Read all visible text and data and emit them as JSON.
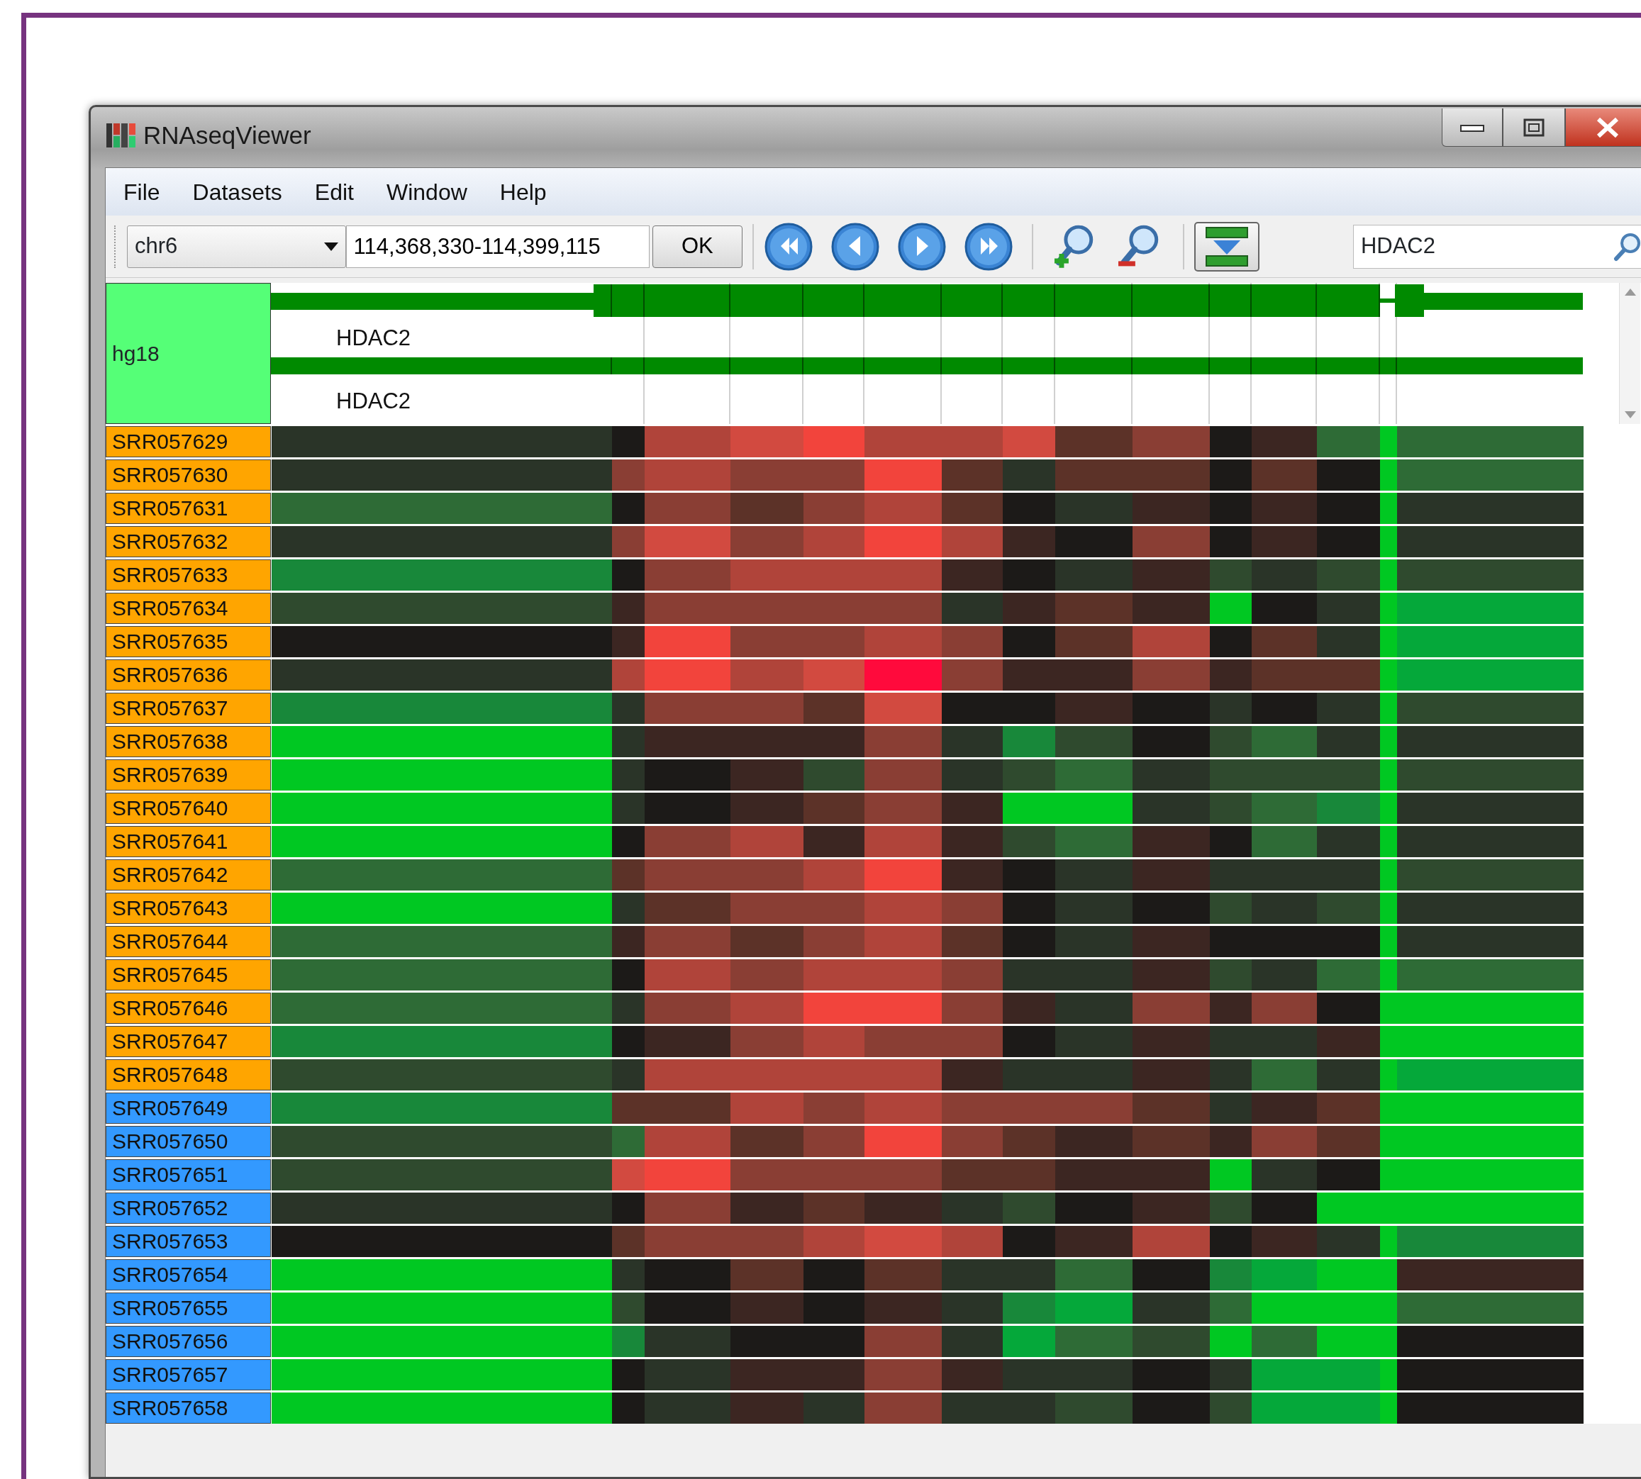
{
  "window": {
    "title": "RNAseqViewer"
  },
  "menu": [
    "File",
    "Datasets",
    "Edit",
    "Window",
    "Help"
  ],
  "toolbar": {
    "chromosome": "chr6",
    "location": "114,368,330-114,399,115",
    "ok_button": "OK",
    "search": "HDAC2"
  },
  "genome": {
    "label": "hg18",
    "tracks": [
      {
        "gene": "HDAC2"
      },
      {
        "gene": "HDAC2"
      }
    ]
  },
  "samples": [
    {
      "label": "SRR057629",
      "color": "#ffa500",
      "cells": [
        {
          "color": "#2a3428"
        },
        {
          "color": "#1c1a18"
        },
        {
          "color": "#b0443a"
        },
        {
          "color": "#d24a40"
        },
        {
          "color": "#f2443c"
        },
        {
          "color": "#b0443a"
        },
        {
          "color": "#b0443a"
        },
        {
          "color": "#d24a40"
        },
        {
          "color": "#5c3228"
        },
        {
          "color": "#8a3e34"
        },
        {
          "color": "#1c1a18"
        },
        {
          "color": "#3c2622"
        },
        {
          "color": "#2e6b36"
        },
        {
          "color": "#00c822"
        },
        {
          "color": "#2e6b36"
        }
      ]
    },
    {
      "label": "SRR057630",
      "color": "#ffa500",
      "cells": [
        {
          "color": "#2a3428"
        },
        {
          "color": "#8a3e34"
        },
        {
          "color": "#b0443a"
        },
        {
          "color": "#8a3e34"
        },
        {
          "color": "#8a3e34"
        },
        {
          "color": "#f2443c"
        },
        {
          "color": "#5c3228"
        },
        {
          "color": "#2a3428"
        },
        {
          "color": "#5c3228"
        },
        {
          "color": "#5c3228"
        },
        {
          "color": "#1c1a18"
        },
        {
          "color": "#5c3228"
        },
        {
          "color": "#1c1a18"
        },
        {
          "color": "#00c822"
        },
        {
          "color": "#2e6b36"
        }
      ]
    },
    {
      "label": "SRR057631",
      "color": "#ffa500",
      "cells": [
        {
          "color": "#2e6b36"
        },
        {
          "color": "#1c1a18"
        },
        {
          "color": "#8a3e34"
        },
        {
          "color": "#5c3228"
        },
        {
          "color": "#8a3e34"
        },
        {
          "color": "#b0443a"
        },
        {
          "color": "#5c3228"
        },
        {
          "color": "#1c1a18"
        },
        {
          "color": "#2a3428"
        },
        {
          "color": "#3c2622"
        },
        {
          "color": "#1c1a18"
        },
        {
          "color": "#3c2622"
        },
        {
          "color": "#1c1a18"
        },
        {
          "color": "#00c822"
        },
        {
          "color": "#2a3428"
        }
      ]
    },
    {
      "label": "SRR057632",
      "color": "#ffa500",
      "cells": [
        {
          "color": "#2a3428"
        },
        {
          "color": "#8a3e34"
        },
        {
          "color": "#d24a40"
        },
        {
          "color": "#8a3e34"
        },
        {
          "color": "#b0443a"
        },
        {
          "color": "#f2443c"
        },
        {
          "color": "#b0443a"
        },
        {
          "color": "#3c2622"
        },
        {
          "color": "#1c1a18"
        },
        {
          "color": "#8a3e34"
        },
        {
          "color": "#1c1a18"
        },
        {
          "color": "#3c2622"
        },
        {
          "color": "#1c1a18"
        },
        {
          "color": "#00c822"
        },
        {
          "color": "#2a3428"
        }
      ]
    },
    {
      "label": "SRR057633",
      "color": "#ffa500",
      "cells": [
        {
          "color": "#18883a"
        },
        {
          "color": "#1c1a18"
        },
        {
          "color": "#8a3e34"
        },
        {
          "color": "#b0443a"
        },
        {
          "color": "#b0443a"
        },
        {
          "color": "#b0443a"
        },
        {
          "color": "#3c2622"
        },
        {
          "color": "#1c1a18"
        },
        {
          "color": "#2a3428"
        },
        {
          "color": "#3c2622"
        },
        {
          "color": "#2f4a2e"
        },
        {
          "color": "#2a3428"
        },
        {
          "color": "#2f4a2e"
        },
        {
          "color": "#00c822"
        },
        {
          "color": "#2f4a2e"
        }
      ]
    },
    {
      "label": "SRR057634",
      "color": "#ffa500",
      "cells": [
        {
          "color": "#2f4a2e"
        },
        {
          "color": "#3c2622"
        },
        {
          "color": "#8a3e34"
        },
        {
          "color": "#8a3e34"
        },
        {
          "color": "#8a3e34"
        },
        {
          "color": "#8a3e34"
        },
        {
          "color": "#2a3428"
        },
        {
          "color": "#3c2622"
        },
        {
          "color": "#5c3228"
        },
        {
          "color": "#3c2622"
        },
        {
          "color": "#00c822"
        },
        {
          "color": "#1c1a18"
        },
        {
          "color": "#2a3428"
        },
        {
          "color": "#00c822"
        },
        {
          "color": "#05a83a"
        }
      ]
    },
    {
      "label": "SRR057635",
      "color": "#ffa500",
      "cells": [
        {
          "color": "#1c1a18"
        },
        {
          "color": "#3c2622"
        },
        {
          "color": "#f2443c"
        },
        {
          "color": "#8a3e34"
        },
        {
          "color": "#8a3e34"
        },
        {
          "color": "#b0443a"
        },
        {
          "color": "#8a3e34"
        },
        {
          "color": "#1c1a18"
        },
        {
          "color": "#5c3228"
        },
        {
          "color": "#b0443a"
        },
        {
          "color": "#1c1a18"
        },
        {
          "color": "#5c3228"
        },
        {
          "color": "#2a3428"
        },
        {
          "color": "#00c822"
        },
        {
          "color": "#05a83a"
        }
      ]
    },
    {
      "label": "SRR057636",
      "color": "#ffa500",
      "cells": [
        {
          "color": "#2a3428"
        },
        {
          "color": "#b0443a"
        },
        {
          "color": "#f2443c"
        },
        {
          "color": "#b0443a"
        },
        {
          "color": "#d24a40"
        },
        {
          "color": "#ff0a3c"
        },
        {
          "color": "#8a3e34"
        },
        {
          "color": "#3c2622"
        },
        {
          "color": "#3c2622"
        },
        {
          "color": "#8a3e34"
        },
        {
          "color": "#3c2622"
        },
        {
          "color": "#5c3228"
        },
        {
          "color": "#5c3228"
        },
        {
          "color": "#00c822"
        },
        {
          "color": "#05a83a"
        }
      ]
    },
    {
      "label": "SRR057637",
      "color": "#ffa500",
      "cells": [
        {
          "color": "#18883a"
        },
        {
          "color": "#2a3428"
        },
        {
          "color": "#8a3e34"
        },
        {
          "color": "#8a3e34"
        },
        {
          "color": "#5c3228"
        },
        {
          "color": "#d24a40"
        },
        {
          "color": "#1c1a18"
        },
        {
          "color": "#1c1a18"
        },
        {
          "color": "#3c2622"
        },
        {
          "color": "#1c1a18"
        },
        {
          "color": "#2a3428"
        },
        {
          "color": "#1c1a18"
        },
        {
          "color": "#2a3428"
        },
        {
          "color": "#00c822"
        },
        {
          "color": "#2f4a2e"
        }
      ]
    },
    {
      "label": "SRR057638",
      "color": "#ffa500",
      "cells": [
        {
          "color": "#00c822"
        },
        {
          "color": "#2a3428"
        },
        {
          "color": "#3c2622"
        },
        {
          "color": "#3c2622"
        },
        {
          "color": "#3c2622"
        },
        {
          "color": "#8a3e34"
        },
        {
          "color": "#2a3428"
        },
        {
          "color": "#18883a"
        },
        {
          "color": "#2f4a2e"
        },
        {
          "color": "#1c1a18"
        },
        {
          "color": "#2f4a2e"
        },
        {
          "color": "#2e6b36"
        },
        {
          "color": "#2a3428"
        },
        {
          "color": "#00c822"
        },
        {
          "color": "#2a3428"
        }
      ]
    },
    {
      "label": "SRR057639",
      "color": "#ffa500",
      "cells": [
        {
          "color": "#00c822"
        },
        {
          "color": "#2a3428"
        },
        {
          "color": "#1c1a18"
        },
        {
          "color": "#3c2622"
        },
        {
          "color": "#2f4a2e"
        },
        {
          "color": "#8a3e34"
        },
        {
          "color": "#2a3428"
        },
        {
          "color": "#2f4a2e"
        },
        {
          "color": "#2e6b36"
        },
        {
          "color": "#2a3428"
        },
        {
          "color": "#2f4a2e"
        },
        {
          "color": "#2f4a2e"
        },
        {
          "color": "#2f4a2e"
        },
        {
          "color": "#00c822"
        },
        {
          "color": "#2f4a2e"
        }
      ]
    },
    {
      "label": "SRR057640",
      "color": "#ffa500",
      "cells": [
        {
          "color": "#00c822"
        },
        {
          "color": "#2a3428"
        },
        {
          "color": "#1c1a18"
        },
        {
          "color": "#3c2622"
        },
        {
          "color": "#5c3228"
        },
        {
          "color": "#8a3e34"
        },
        {
          "color": "#3c2622"
        },
        {
          "color": "#00c822"
        },
        {
          "color": "#00c822"
        },
        {
          "color": "#2a3428"
        },
        {
          "color": "#2f4a2e"
        },
        {
          "color": "#2e6b36"
        },
        {
          "color": "#18883a"
        },
        {
          "color": "#00c822"
        },
        {
          "color": "#2a3428"
        }
      ]
    },
    {
      "label": "SRR057641",
      "color": "#ffa500",
      "cells": [
        {
          "color": "#00c822"
        },
        {
          "color": "#1c1a18"
        },
        {
          "color": "#8a3e34"
        },
        {
          "color": "#b0443a"
        },
        {
          "color": "#3c2622"
        },
        {
          "color": "#b0443a"
        },
        {
          "color": "#3c2622"
        },
        {
          "color": "#2f4a2e"
        },
        {
          "color": "#2e6b36"
        },
        {
          "color": "#3c2622"
        },
        {
          "color": "#1c1a18"
        },
        {
          "color": "#2e6b36"
        },
        {
          "color": "#2a3428"
        },
        {
          "color": "#00c822"
        },
        {
          "color": "#2a3428"
        }
      ]
    },
    {
      "label": "SRR057642",
      "color": "#ffa500",
      "cells": [
        {
          "color": "#2e6b36"
        },
        {
          "color": "#5c3228"
        },
        {
          "color": "#8a3e34"
        },
        {
          "color": "#8a3e34"
        },
        {
          "color": "#b0443a"
        },
        {
          "color": "#f2443c"
        },
        {
          "color": "#3c2622"
        },
        {
          "color": "#1c1a18"
        },
        {
          "color": "#2a3428"
        },
        {
          "color": "#3c2622"
        },
        {
          "color": "#2a3428"
        },
        {
          "color": "#2a3428"
        },
        {
          "color": "#2a3428"
        },
        {
          "color": "#00c822"
        },
        {
          "color": "#2f4a2e"
        }
      ]
    },
    {
      "label": "SRR057643",
      "color": "#ffa500",
      "cells": [
        {
          "color": "#00c822"
        },
        {
          "color": "#2a3428"
        },
        {
          "color": "#5c3228"
        },
        {
          "color": "#8a3e34"
        },
        {
          "color": "#8a3e34"
        },
        {
          "color": "#b0443a"
        },
        {
          "color": "#8a3e34"
        },
        {
          "color": "#1c1a18"
        },
        {
          "color": "#2a3428"
        },
        {
          "color": "#1c1a18"
        },
        {
          "color": "#2f4a2e"
        },
        {
          "color": "#2a3428"
        },
        {
          "color": "#2f4a2e"
        },
        {
          "color": "#00c822"
        },
        {
          "color": "#2a3428"
        }
      ]
    },
    {
      "label": "SRR057644",
      "color": "#ffa500",
      "cells": [
        {
          "color": "#2e6b36"
        },
        {
          "color": "#3c2622"
        },
        {
          "color": "#8a3e34"
        },
        {
          "color": "#5c3228"
        },
        {
          "color": "#8a3e34"
        },
        {
          "color": "#b0443a"
        },
        {
          "color": "#5c3228"
        },
        {
          "color": "#1c1a18"
        },
        {
          "color": "#2a3428"
        },
        {
          "color": "#3c2622"
        },
        {
          "color": "#1c1a18"
        },
        {
          "color": "#1c1a18"
        },
        {
          "color": "#1c1a18"
        },
        {
          "color": "#00c822"
        },
        {
          "color": "#2a3428"
        }
      ]
    },
    {
      "label": "SRR057645",
      "color": "#ffa500",
      "cells": [
        {
          "color": "#2e6b36"
        },
        {
          "color": "#1c1a18"
        },
        {
          "color": "#b0443a"
        },
        {
          "color": "#8a3e34"
        },
        {
          "color": "#b0443a"
        },
        {
          "color": "#b0443a"
        },
        {
          "color": "#8a3e34"
        },
        {
          "color": "#2a3428"
        },
        {
          "color": "#2a3428"
        },
        {
          "color": "#3c2622"
        },
        {
          "color": "#2f4a2e"
        },
        {
          "color": "#2a3428"
        },
        {
          "color": "#2e6b36"
        },
        {
          "color": "#00c822"
        },
        {
          "color": "#2e6b36"
        }
      ]
    },
    {
      "label": "SRR057646",
      "color": "#ffa500",
      "cells": [
        {
          "color": "#2e6b36"
        },
        {
          "color": "#2a3428"
        },
        {
          "color": "#8a3e34"
        },
        {
          "color": "#b0443a"
        },
        {
          "color": "#f2443c"
        },
        {
          "color": "#f2443c"
        },
        {
          "color": "#8a3e34"
        },
        {
          "color": "#3c2622"
        },
        {
          "color": "#2a3428"
        },
        {
          "color": "#8a3e34"
        },
        {
          "color": "#3c2622"
        },
        {
          "color": "#8a3e34"
        },
        {
          "color": "#1c1a18"
        },
        {
          "color": "#00c822"
        },
        {
          "color": "#00c822"
        }
      ]
    },
    {
      "label": "SRR057647",
      "color": "#ffa500",
      "cells": [
        {
          "color": "#18883a"
        },
        {
          "color": "#1c1a18"
        },
        {
          "color": "#3c2622"
        },
        {
          "color": "#8a3e34"
        },
        {
          "color": "#b0443a"
        },
        {
          "color": "#8a3e34"
        },
        {
          "color": "#8a3e34"
        },
        {
          "color": "#1c1a18"
        },
        {
          "color": "#2a3428"
        },
        {
          "color": "#3c2622"
        },
        {
          "color": "#2a3428"
        },
        {
          "color": "#2a3428"
        },
        {
          "color": "#3c2622"
        },
        {
          "color": "#00c822"
        },
        {
          "color": "#00c822"
        }
      ]
    },
    {
      "label": "SRR057648",
      "color": "#ffa500",
      "cells": [
        {
          "color": "#2f4a2e"
        },
        {
          "color": "#2a3428"
        },
        {
          "color": "#b0443a"
        },
        {
          "color": "#b0443a"
        },
        {
          "color": "#b0443a"
        },
        {
          "color": "#b0443a"
        },
        {
          "color": "#3c2622"
        },
        {
          "color": "#2a3428"
        },
        {
          "color": "#2a3428"
        },
        {
          "color": "#3c2622"
        },
        {
          "color": "#2a3428"
        },
        {
          "color": "#2e6b36"
        },
        {
          "color": "#2a3428"
        },
        {
          "color": "#00c822"
        },
        {
          "color": "#05a83a"
        }
      ]
    },
    {
      "label": "SRR057649",
      "color": "#3399ff",
      "cells": [
        {
          "color": "#18883a"
        },
        {
          "color": "#5c3228"
        },
        {
          "color": "#5c3228"
        },
        {
          "color": "#b0443a"
        },
        {
          "color": "#8a3e34"
        },
        {
          "color": "#b0443a"
        },
        {
          "color": "#8a3e34"
        },
        {
          "color": "#8a3e34"
        },
        {
          "color": "#8a3e34"
        },
        {
          "color": "#5c3228"
        },
        {
          "color": "#2a3428"
        },
        {
          "color": "#3c2622"
        },
        {
          "color": "#5c3228"
        },
        {
          "color": "#00c822"
        },
        {
          "color": "#00c822"
        }
      ]
    },
    {
      "label": "SRR057650",
      "color": "#3399ff",
      "cells": [
        {
          "color": "#2f4a2e"
        },
        {
          "color": "#2e6b36"
        },
        {
          "color": "#b0443a"
        },
        {
          "color": "#5c3228"
        },
        {
          "color": "#8a3e34"
        },
        {
          "color": "#f2443c"
        },
        {
          "color": "#8a3e34"
        },
        {
          "color": "#5c3228"
        },
        {
          "color": "#3c2622"
        },
        {
          "color": "#5c3228"
        },
        {
          "color": "#3c2622"
        },
        {
          "color": "#8a3e34"
        },
        {
          "color": "#5c3228"
        },
        {
          "color": "#00c822"
        },
        {
          "color": "#00c822"
        }
      ]
    },
    {
      "label": "SRR057651",
      "color": "#3399ff",
      "cells": [
        {
          "color": "#2f4a2e"
        },
        {
          "color": "#d24a40"
        },
        {
          "color": "#f2443c"
        },
        {
          "color": "#8a3e34"
        },
        {
          "color": "#8a3e34"
        },
        {
          "color": "#8a3e34"
        },
        {
          "color": "#5c3228"
        },
        {
          "color": "#5c3228"
        },
        {
          "color": "#3c2622"
        },
        {
          "color": "#3c2622"
        },
        {
          "color": "#00c822"
        },
        {
          "color": "#2a3428"
        },
        {
          "color": "#1c1a18"
        },
        {
          "color": "#00c822"
        },
        {
          "color": "#00c822"
        }
      ]
    },
    {
      "label": "SRR057652",
      "color": "#3399ff",
      "cells": [
        {
          "color": "#2a3428"
        },
        {
          "color": "#1c1a18"
        },
        {
          "color": "#8a3e34"
        },
        {
          "color": "#3c2622"
        },
        {
          "color": "#5c3228"
        },
        {
          "color": "#3c2622"
        },
        {
          "color": "#2a3428"
        },
        {
          "color": "#2f4a2e"
        },
        {
          "color": "#1c1a18"
        },
        {
          "color": "#3c2622"
        },
        {
          "color": "#2f4a2e"
        },
        {
          "color": "#1c1a18"
        },
        {
          "color": "#00c822"
        },
        {
          "color": "#00c822"
        },
        {
          "color": "#00c822"
        }
      ]
    },
    {
      "label": "SRR057653",
      "color": "#3399ff",
      "cells": [
        {
          "color": "#1c1a18"
        },
        {
          "color": "#5c3228"
        },
        {
          "color": "#8a3e34"
        },
        {
          "color": "#8a3e34"
        },
        {
          "color": "#b0443a"
        },
        {
          "color": "#d24a40"
        },
        {
          "color": "#b0443a"
        },
        {
          "color": "#1c1a18"
        },
        {
          "color": "#3c2622"
        },
        {
          "color": "#b0443a"
        },
        {
          "color": "#1c1a18"
        },
        {
          "color": "#3c2622"
        },
        {
          "color": "#2a3428"
        },
        {
          "color": "#00c822"
        },
        {
          "color": "#18883a"
        }
      ]
    },
    {
      "label": "SRR057654",
      "color": "#3399ff",
      "cells": [
        {
          "color": "#00c822"
        },
        {
          "color": "#2a3428"
        },
        {
          "color": "#1c1a18"
        },
        {
          "color": "#5c3228"
        },
        {
          "color": "#1c1a18"
        },
        {
          "color": "#5c3228"
        },
        {
          "color": "#2a3428"
        },
        {
          "color": "#2a3428"
        },
        {
          "color": "#2e6b36"
        },
        {
          "color": "#1c1a18"
        },
        {
          "color": "#18883a"
        },
        {
          "color": "#05a83a"
        },
        {
          "color": "#00c822"
        },
        {
          "color": "#00c822"
        },
        {
          "color": "#3c2622"
        }
      ]
    },
    {
      "label": "SRR057655",
      "color": "#3399ff",
      "cells": [
        {
          "color": "#00c822"
        },
        {
          "color": "#2f4a2e"
        },
        {
          "color": "#1c1a18"
        },
        {
          "color": "#3c2622"
        },
        {
          "color": "#1c1a18"
        },
        {
          "color": "#3c2622"
        },
        {
          "color": "#2a3428"
        },
        {
          "color": "#18883a"
        },
        {
          "color": "#05a83a"
        },
        {
          "color": "#2a3428"
        },
        {
          "color": "#2e6b36"
        },
        {
          "color": "#00c822"
        },
        {
          "color": "#00c822"
        },
        {
          "color": "#00c822"
        },
        {
          "color": "#2e6b36"
        }
      ]
    },
    {
      "label": "SRR057656",
      "color": "#3399ff",
      "cells": [
        {
          "color": "#00c822"
        },
        {
          "color": "#18883a"
        },
        {
          "color": "#2a3428"
        },
        {
          "color": "#1c1a18"
        },
        {
          "color": "#1c1a18"
        },
        {
          "color": "#8a3e34"
        },
        {
          "color": "#2a3428"
        },
        {
          "color": "#05a83a"
        },
        {
          "color": "#2e6b36"
        },
        {
          "color": "#2f4a2e"
        },
        {
          "color": "#00c822"
        },
        {
          "color": "#2e6b36"
        },
        {
          "color": "#00c822"
        },
        {
          "color": "#00c822"
        },
        {
          "color": "#1c1a18"
        }
      ]
    },
    {
      "label": "SRR057657",
      "color": "#3399ff",
      "cells": [
        {
          "color": "#00c822"
        },
        {
          "color": "#1c1a18"
        },
        {
          "color": "#2a3428"
        },
        {
          "color": "#3c2622"
        },
        {
          "color": "#3c2622"
        },
        {
          "color": "#8a3e34"
        },
        {
          "color": "#3c2622"
        },
        {
          "color": "#2a3428"
        },
        {
          "color": "#2a3428"
        },
        {
          "color": "#1c1a18"
        },
        {
          "color": "#2a3428"
        },
        {
          "color": "#05a83a"
        },
        {
          "color": "#05a83a"
        },
        {
          "color": "#00c822"
        },
        {
          "color": "#1c1a18"
        }
      ]
    },
    {
      "label": "SRR057658",
      "color": "#3399ff",
      "cells": [
        {
          "color": "#00c822"
        },
        {
          "color": "#1c1a18"
        },
        {
          "color": "#2a3428"
        },
        {
          "color": "#3c2622"
        },
        {
          "color": "#2a3428"
        },
        {
          "color": "#8a3e34"
        },
        {
          "color": "#2a3428"
        },
        {
          "color": "#2a3428"
        },
        {
          "color": "#2f4a2e"
        },
        {
          "color": "#1c1a18"
        },
        {
          "color": "#2f4a2e"
        },
        {
          "color": "#05a83a"
        },
        {
          "color": "#05a83a"
        },
        {
          "color": "#00c822"
        },
        {
          "color": "#1c1a18"
        }
      ]
    }
  ]
}
